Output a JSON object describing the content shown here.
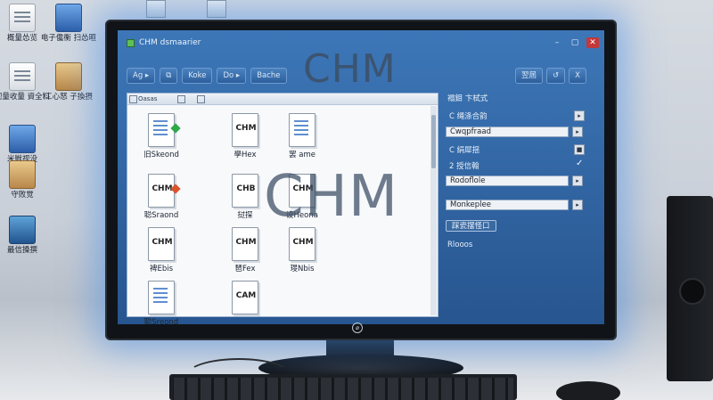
{
  "desktop": {
    "icons": [
      {
        "label": "概量怂览",
        "icon": "document-icon"
      },
      {
        "label": "电子儳衡 扫怂晅",
        "icon": "pc-icon"
      },
      {
        "label": "视量收量 資全料",
        "icon": "document-icon"
      },
      {
        "label": "工心怒 子換摂",
        "icon": "network-icon"
      },
      {
        "label": "米獣视没",
        "icon": "blue-folder-icon"
      },
      {
        "label": "守败觉",
        "icon": "box-icon"
      },
      {
        "label": "最信搡撰",
        "icon": "book-icon"
      }
    ]
  },
  "window": {
    "title": "CHM dsmaarier",
    "banner": "CHM",
    "watermark": "CHM",
    "controls": {
      "minimize": "–",
      "maximize": "▢",
      "close": "✕"
    }
  },
  "toolbar": {
    "buttons": [
      "Ag ▸",
      "",
      "Koke",
      "Do ▸",
      "Bache"
    ],
    "right_buttons": [
      "翌屆",
      "↺",
      "X"
    ]
  },
  "file_panel": {
    "header_tag": "Oasas",
    "files": [
      {
        "name": "旧Skeond",
        "badge": "#2fa84a",
        "type": "lines"
      },
      {
        "name": "學Hex",
        "badge": "",
        "type": "chm",
        "text": "CHM"
      },
      {
        "name": "罢 ame",
        "badge": "",
        "type": "lines"
      },
      {
        "name": "聪Sraond",
        "badge": "#d9532b",
        "type": "chm",
        "text": "CHM"
      },
      {
        "name": "挝探",
        "badge": "",
        "type": "chm",
        "text": "CHB"
      },
      {
        "name": "设Heona",
        "badge": "",
        "type": "chm",
        "text": "CHM"
      },
      {
        "name": "裨Ebis",
        "badge": "",
        "type": "chm",
        "text": "CHM"
      },
      {
        "name": "琶Fex",
        "badge": "",
        "type": "chm",
        "text": "CHM"
      },
      {
        "name": "琝Nbis",
        "badge": "",
        "type": "chm",
        "text": "CHM"
      },
      {
        "name": "聪Sreond",
        "badge": "",
        "type": "lines"
      },
      {
        "name": "",
        "badge": "",
        "type": "chm",
        "text": "CAM"
      }
    ]
  },
  "properties": {
    "header": "褟鉬 卞栻式",
    "rows": [
      {
        "label": "C 绳涤合韵",
        "kind": "button",
        "btn": "▸"
      },
      {
        "label": "",
        "kind": "field",
        "value": "Cwqpfraad",
        "btn": "▸"
      },
      {
        "label": "C 绢犀揺",
        "kind": "button",
        "btn": "■"
      },
      {
        "label": "2 授信翰",
        "kind": "check",
        "btn": "✓"
      },
      {
        "label": "",
        "kind": "field",
        "value": "Rodoflole",
        "btn": "▸"
      },
      {
        "label": "",
        "kind": "field",
        "value": "Monkeplee",
        "btn": "▸"
      },
      {
        "label": "",
        "kind": "box",
        "value": "踩瓷摆怪口"
      },
      {
        "label": "",
        "kind": "bullet",
        "value": "Rlooos"
      }
    ]
  }
}
